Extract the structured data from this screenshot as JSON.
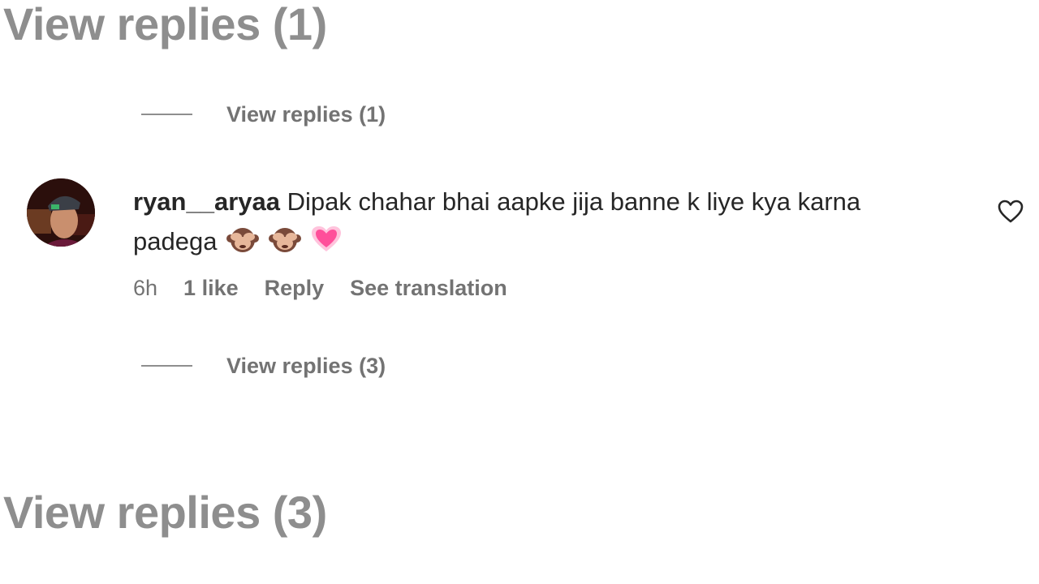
{
  "zoom_labels": {
    "top": "View replies (1)",
    "bottom": "View replies (3)"
  },
  "thread": {
    "view_replies_1": "View replies (1)",
    "view_replies_2": "View replies (3)"
  },
  "comment": {
    "username": "ryan__aryaa",
    "text": "Dipak chahar bhai aapke jija banne k liye kya karna padega",
    "emojis": [
      "see-no-evil-monkey",
      "see-no-evil-monkey",
      "growing-heart"
    ],
    "time": "6h",
    "likes": "1 like",
    "reply_label": "Reply",
    "translate_label": "See translation",
    "like_icon": "heart-outline-icon"
  },
  "colors": {
    "secondary_text": "#737373",
    "primary_text": "#262626",
    "heart_pink": "#ff4f9a"
  }
}
